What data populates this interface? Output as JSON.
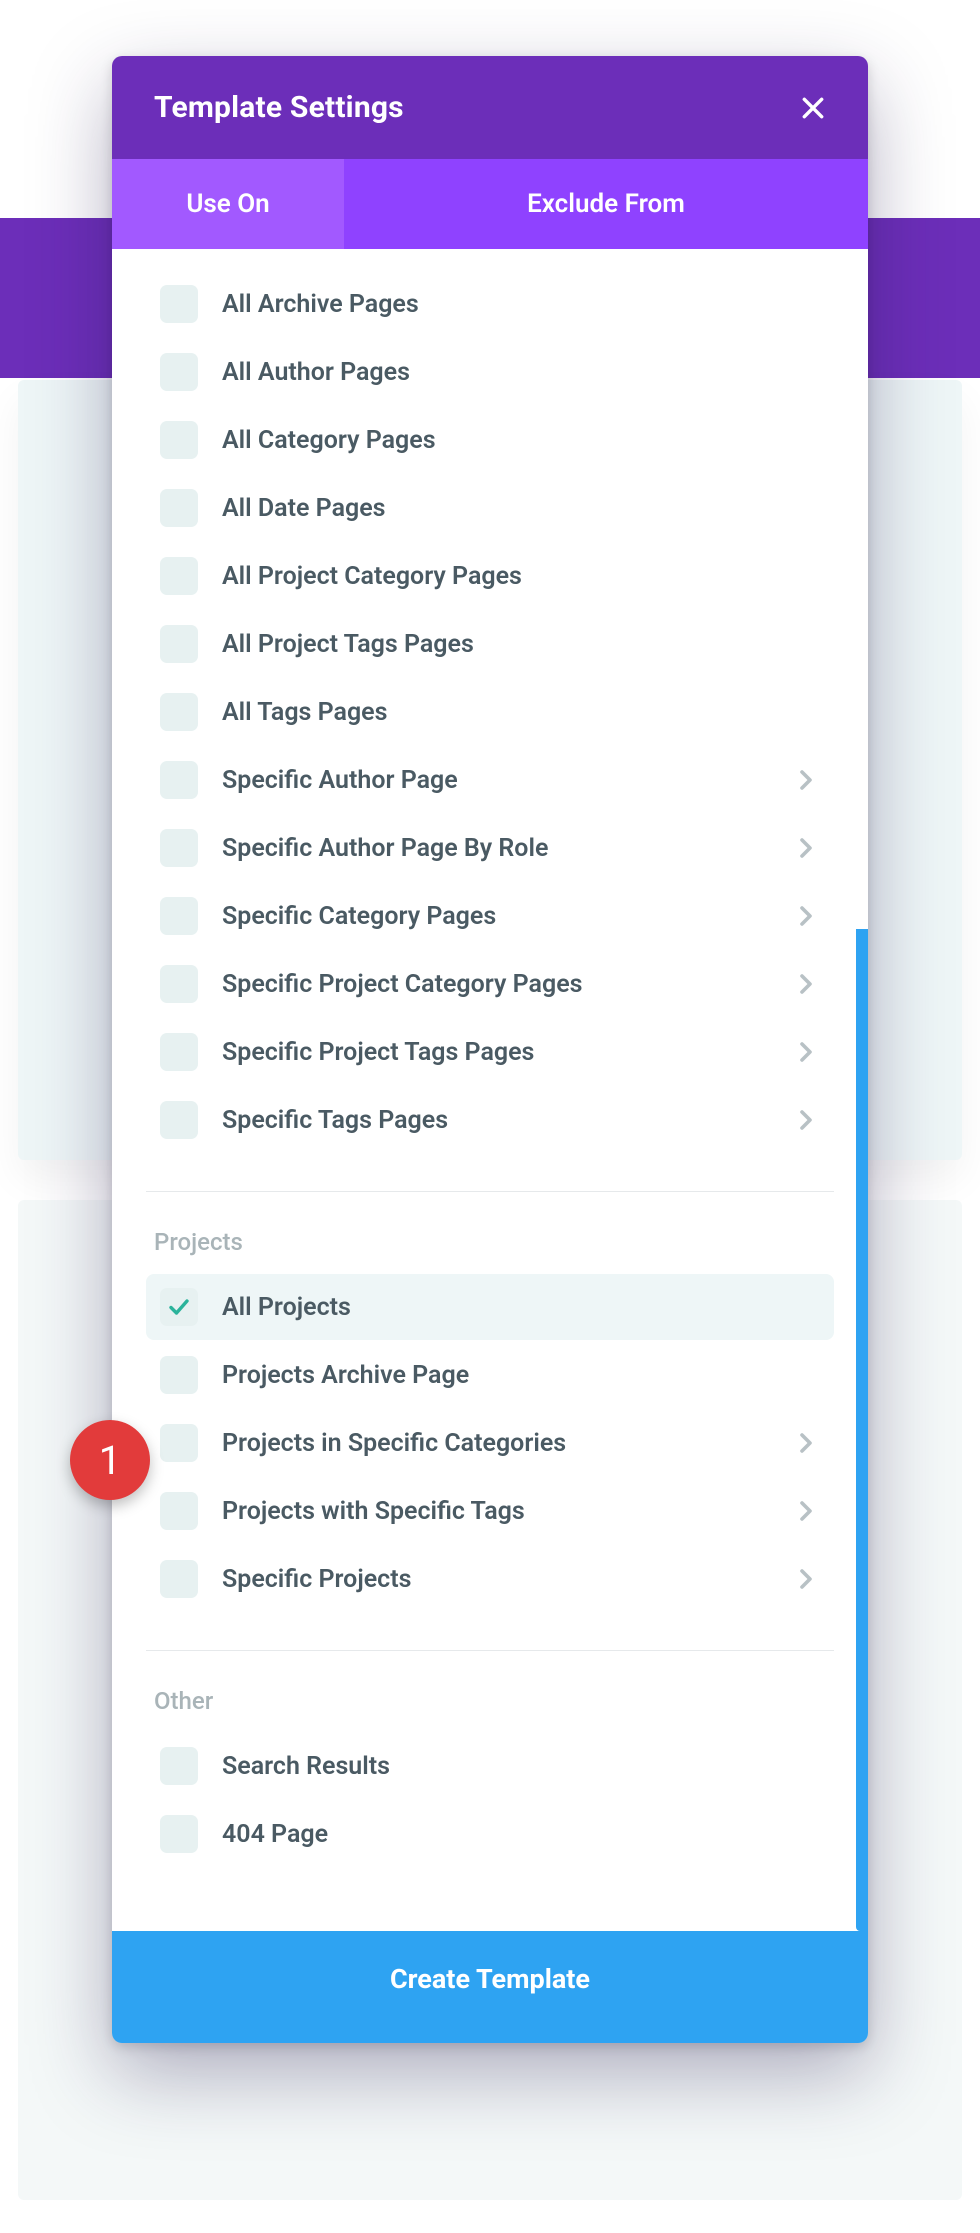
{
  "modal": {
    "title": "Template Settings",
    "tabs": {
      "use_on": "Use On",
      "exclude_from": "Exclude From"
    },
    "footer": "Create Template"
  },
  "sections": {
    "archive": {
      "items": [
        {
          "label": "All Archive Pages",
          "chevron": false
        },
        {
          "label": "All Author Pages",
          "chevron": false
        },
        {
          "label": "All Category Pages",
          "chevron": false
        },
        {
          "label": "All Date Pages",
          "chevron": false
        },
        {
          "label": "All Project Category Pages",
          "chevron": false
        },
        {
          "label": "All Project Tags Pages",
          "chevron": false
        },
        {
          "label": "All Tags Pages",
          "chevron": false
        },
        {
          "label": "Specific Author Page",
          "chevron": true
        },
        {
          "label": "Specific Author Page By Role",
          "chevron": true
        },
        {
          "label": "Specific Category Pages",
          "chevron": true
        },
        {
          "label": "Specific Project Category Pages",
          "chevron": true
        },
        {
          "label": "Specific Project Tags Pages",
          "chevron": true
        },
        {
          "label": "Specific Tags Pages",
          "chevron": true
        }
      ]
    },
    "projects": {
      "title": "Projects",
      "items": [
        {
          "label": "All Projects",
          "chevron": false,
          "selected": true
        },
        {
          "label": "Projects Archive Page",
          "chevron": false
        },
        {
          "label": "Projects in Specific Categories",
          "chevron": true
        },
        {
          "label": "Projects with Specific Tags",
          "chevron": true
        },
        {
          "label": "Specific Projects",
          "chevron": true
        }
      ]
    },
    "other": {
      "title": "Other",
      "items": [
        {
          "label": "Search Results",
          "chevron": false
        },
        {
          "label": "404 Page",
          "chevron": false
        }
      ]
    }
  },
  "callout": {
    "number": "1"
  }
}
